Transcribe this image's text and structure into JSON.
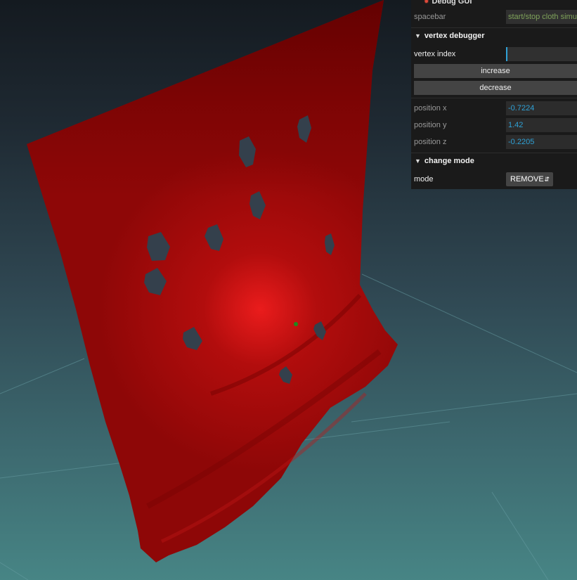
{
  "gui": {
    "title": "Debug GUI",
    "spacebar": {
      "label": "spacebar",
      "value": "start/stop cloth simulation"
    },
    "vertex_debugger": {
      "title": "vertex debugger",
      "vertex_index_label": "vertex index",
      "vertex_index_value": "",
      "increase_label": "increase",
      "decrease_label": "decrease",
      "position_x_label": "position x",
      "position_x": "-0.7224",
      "position_y_label": "position y",
      "position_y": "1.42",
      "position_z_label": "position z",
      "position_z": "-0.2205"
    },
    "change_mode": {
      "title": "change mode",
      "mode_label": "mode",
      "mode_value": "REMOVE"
    }
  },
  "colors": {
    "cloth": "#9a0a0a",
    "highlight": "#e81c1c",
    "hole": "#34404c",
    "accent": "#2fa1d6",
    "vertex_marker": "#1f8a1f"
  },
  "icons": {
    "folder_open": "chevron-down-icon",
    "select": "up-down-arrows-icon",
    "title": "bug-icon"
  }
}
